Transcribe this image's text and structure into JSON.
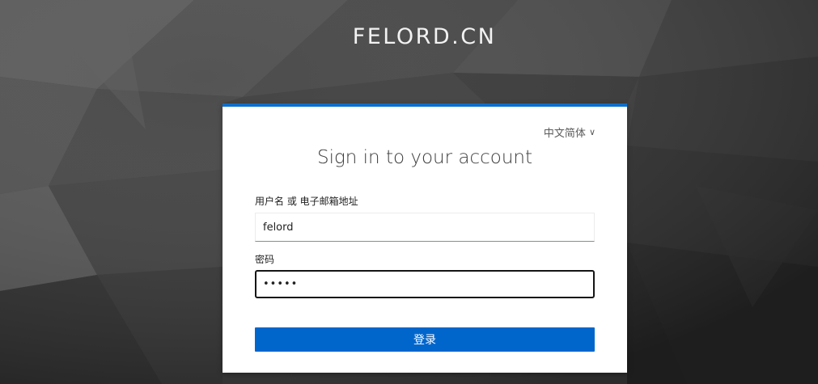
{
  "realm": {
    "title": "FELORD.CN"
  },
  "login": {
    "locale_label": "中文简体",
    "locale_chevron": "∨",
    "heading": "Sign in to your account",
    "username_label": "用户名 或 电子邮箱地址",
    "username_value": "felord",
    "password_label": "密码",
    "password_value": "•••••",
    "submit_label": "登录"
  },
  "colors": {
    "accent": "#0066cc",
    "card_top_border": "#0b6fcf",
    "background": "#3a3a3a"
  },
  "icons": {
    "locale_dropdown": "chevron-down-icon"
  }
}
